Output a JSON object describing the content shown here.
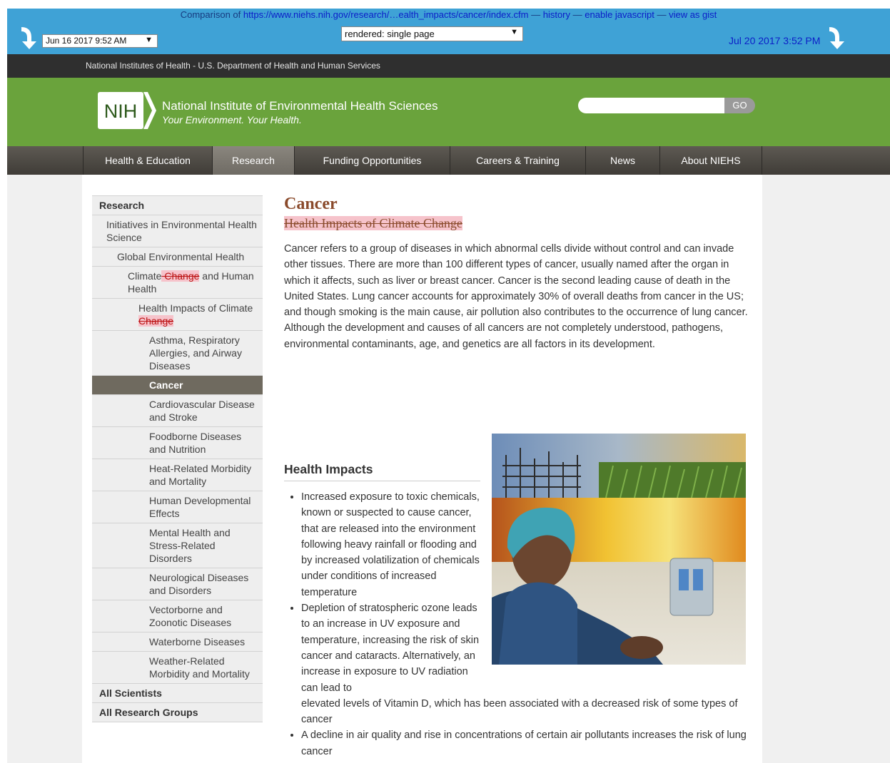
{
  "compare_bar": {
    "prefix": "Comparison of",
    "url": "https://www.niehs.nih.gov/research/…ealth_impacts/cancer/index.cfm",
    "dash1": "—",
    "history": "history",
    "dash2": "—",
    "enable_js": "enable javascript",
    "dash3": "—",
    "view_gist": "view as gist",
    "left_date": "Jun 16 2017 9:52 AM",
    "mode": "rendered: single page",
    "right_date": "Jul 20 2017 3:52 PM",
    "caret": "▼"
  },
  "header": {
    "hhs": "National Institutes of Health  -  U.S. Department of Health and Human Services",
    "logo_text": "NIH",
    "title": "National Institute of Environmental Health Sciences",
    "tagline": "Your Environment. Your Health.",
    "search_placeholder": "",
    "go": "GO"
  },
  "nav": [
    "Health & Education",
    "Research",
    "Funding Opportunities",
    "Careers & Training",
    "News",
    "About NIEHS"
  ],
  "sidenav": {
    "research": "Research",
    "initiatives": "Initiatives in Environmental Health Science",
    "global": "Global Environmental Health",
    "climate_a": "Climate",
    "climate_del": " Change",
    "climate_b": " and Human Health",
    "hi_a": "Health Impacts of Climate ",
    "hi_del": "Change",
    "asthma": "Asthma, Respiratory Allergies, and Airway Diseases",
    "cancer": "Cancer",
    "cardio": "Cardiovascular Disease and Stroke",
    "food": "Foodborne Diseases and Nutrition",
    "heat": "Heat-Related Morbidity and Mortality",
    "human": "Human Developmental Effects",
    "mental": "Mental Health and Stress-Related Disorders",
    "neuro": "Neurological Diseases and Disorders",
    "vector": "Vectorborne and Zoonotic Diseases",
    "water": "Waterborne Diseases",
    "weather": "Weather-Related Morbidity and Mortality",
    "scientists": "All Scientists",
    "groups": "All Research Groups"
  },
  "main": {
    "title": "Cancer",
    "deleted_subtitle": "Health Impacts of Climate Change",
    "intro": "Cancer refers to a group of diseases in which abnormal cells divide without control and can invade other tissues. There are more than 100 different types of cancer, usually named after the organ in which it affects, such as liver or breast cancer. Cancer is the second leading cause of death in the United States. Lung cancer accounts for approximately 30% of overall deaths from cancer in the US; and though smoking is the main cause, air pollution also contributes to the occurrence of lung cancer. Although the development and causes of all cancers are not completely understood, pathogens, environmental contaminants, age, and genetics are all factors in its development.",
    "health_impacts_heading": "Health Impacts",
    "bullet1": "Increased exposure to toxic chemicals, known or suspected to cause cancer, that are released into the environment following heavy rainfall or flooding and by increased volatilization of chemicals under conditions of increased temperature",
    "bullet2a": "Depletion of stratospheric ozone leads to an increase in UV exposure and temperature, increasing the risk of skin cancer and cataracts. Alternatively, an increase in exposure to UV radiation can lead to",
    "bullet2b": "elevated levels of Vitamin D, which has been associated with a decreased risk of some types of cancer",
    "bullet3": "A decline in air quality and rise in concentrations of certain air pollutants increases the risk of lung cancer"
  },
  "colors": {
    "compare_bar": "#3fa2d6",
    "nih_green": "#6aa33c",
    "deleted_highlight": "#f6c3cb",
    "title_brown": "#8a4a2b"
  }
}
